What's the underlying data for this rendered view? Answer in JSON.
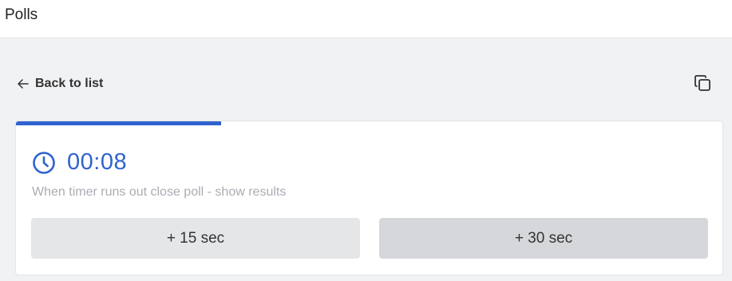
{
  "header": {
    "title": "Polls"
  },
  "nav": {
    "back_label": "Back to list"
  },
  "timer": {
    "time": "00:08",
    "hint": "When timer runs out close poll - show results",
    "progress_fraction": 0.29
  },
  "actions": {
    "add_15_label": "+ 15 sec",
    "add_30_label": "+ 30 sec"
  },
  "colors": {
    "accent": "#2f63cf",
    "background": "#f1f2f4",
    "card": "#ffffff",
    "button": "#e5e6e8",
    "button_hover": "#d5d7db"
  },
  "icons": {
    "back": "arrow-left-icon",
    "copy": "copy-icon",
    "clock": "clock-icon"
  }
}
